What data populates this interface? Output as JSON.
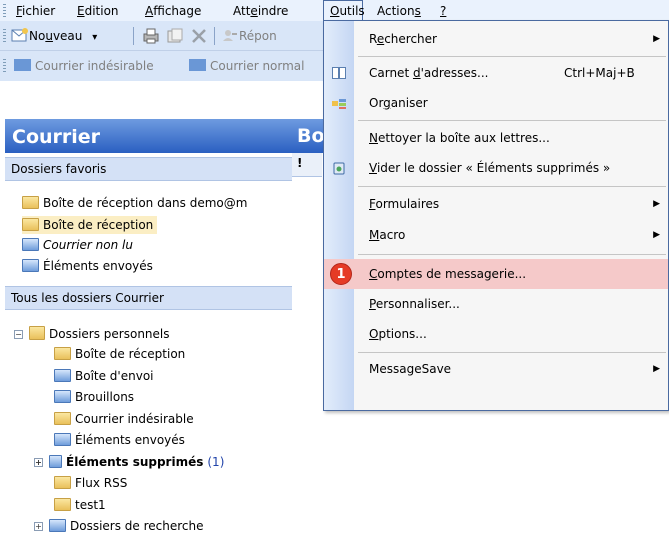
{
  "menubar": {
    "items": [
      {
        "pre": "",
        "u": "F",
        "post": "ichier"
      },
      {
        "pre": "",
        "u": "E",
        "post": "dition"
      },
      {
        "pre": "",
        "u": "A",
        "post": "ffichage"
      },
      {
        "pre": "Att",
        "u": "e",
        "post": "indre"
      },
      {
        "pre": "",
        "u": "O",
        "post": "utils"
      },
      {
        "pre": "Action",
        "u": "s",
        "post": ""
      },
      {
        "pre": "",
        "u": "?",
        "post": ""
      }
    ]
  },
  "toolbar1": {
    "new_pre": "No",
    "new_u": "u",
    "new_post": "veau",
    "new_dropdown": "▾",
    "reply": "Répon"
  },
  "toolbar2": {
    "junk": "Courrier indésirable",
    "normal": "Courrier normal"
  },
  "navpane": {
    "title": "Courrier",
    "favorites_header": "Dossiers favoris",
    "favorites": [
      "Boîte de réception dans demo@m",
      "Boîte de réception",
      "Courrier non lu",
      "Éléments envoyés"
    ],
    "all_header": "Tous les dossiers Courrier",
    "root": "Dossiers personnels",
    "folders": [
      "Boîte de réception",
      "Boîte d'envoi",
      "Brouillons",
      "Courrier indésirable",
      "Éléments envoyés",
      "Éléments supprimés",
      "Flux RSS",
      "test1",
      "Dossiers de recherche"
    ],
    "deleted_count": "(1)"
  },
  "main": {
    "title": "Bo",
    "col_icon": "!"
  },
  "dropdown": {
    "items": [
      {
        "pre": "R",
        "u": "e",
        "post": "chercher"
      },
      {
        "pre": "Carnet ",
        "u": "d",
        "post": "'adresses..."
      },
      {
        "pre": "Or",
        "u": "g",
        "post": "aniser"
      },
      {
        "pre": "",
        "u": "N",
        "post": "ettoyer la boîte aux lettres..."
      },
      {
        "pre": "",
        "u": "V",
        "post": "ider le dossier « Éléments supprimés »"
      },
      {
        "pre": "",
        "u": "F",
        "post": "ormulaires"
      },
      {
        "pre": "",
        "u": "M",
        "post": "acro"
      },
      {
        "pre": "",
        "u": "C",
        "post": "omptes de messagerie..."
      },
      {
        "pre": "",
        "u": "P",
        "post": "ersonnaliser..."
      },
      {
        "pre": "",
        "u": "O",
        "post": "ptions..."
      },
      {
        "pre": "MessageSave",
        "u": "",
        "post": ""
      }
    ],
    "address_shortcut": "Ctrl+Maj+B",
    "badge_number": "1",
    "submenu_arrow": "▶"
  },
  "colors": {
    "accent": "#2a5fc1",
    "highlight": "#f5c9c9",
    "badge": "#e53b26"
  }
}
